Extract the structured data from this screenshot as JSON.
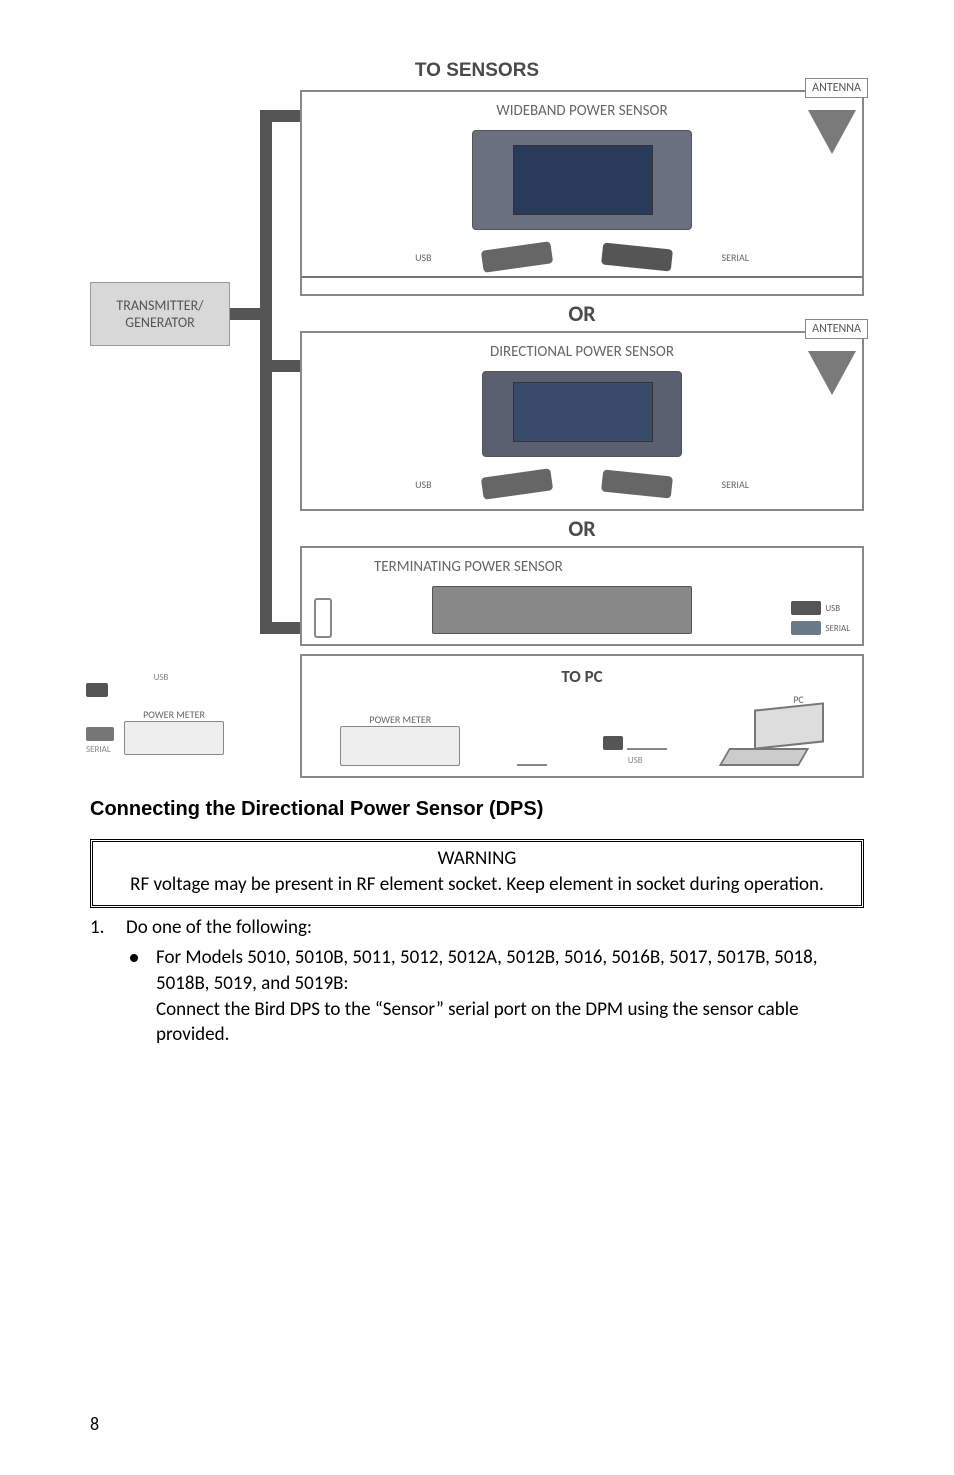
{
  "diagram": {
    "top_title": "TO SENSORS",
    "tx_gen": "TRANSMITTER/\nGENERATOR",
    "wideband": {
      "title": "WIDEBAND POWER SENSOR",
      "antenna": "ANTENNA",
      "usb": "USB",
      "serial": "SERIAL"
    },
    "or": "OR",
    "directional": {
      "title": "DIRECTIONAL POWER SENSOR",
      "antenna": "ANTENNA",
      "usb": "USB",
      "serial": "SERIAL"
    },
    "terminating": {
      "title": "TERMINATING POWER SENSOR",
      "usb": "USB",
      "serial": "SERIAL"
    },
    "to_pc": "TO PC",
    "power_meter": "POWER METER",
    "pc": "PC",
    "usb_small": "USB",
    "serial_small": "SERIAL"
  },
  "heading": "Connecting the Directional Power Sensor (DPS)",
  "warning": {
    "title": "WARNING",
    "body": "RF voltage may be present in RF element socket. Keep element in socket during operation."
  },
  "step": {
    "num": "1.",
    "text": "Do one of the following:"
  },
  "bullet": {
    "line1": "For Models 5010, 5010B, 5011, 5012, 5012A, 5012B, 5016, 5016B, 5017, 5017B, 5018, 5018B, 5019, and 5019B:",
    "line2": "Connect the Bird DPS to the “Sensor” serial port on the DPM using the sensor cable provided."
  },
  "page_number": "8"
}
